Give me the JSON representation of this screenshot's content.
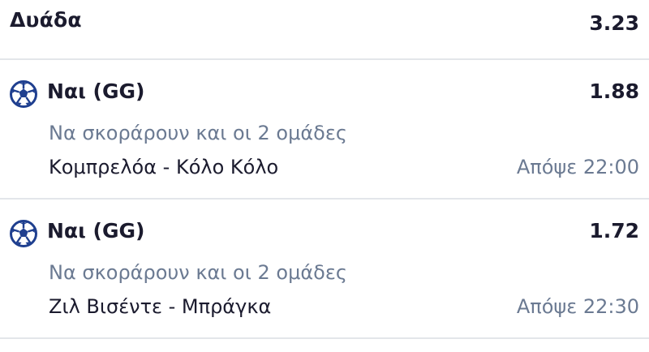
{
  "header": {
    "title": "Δυάδα",
    "odds": "3.23"
  },
  "selections": [
    {
      "name": "Ναι (GG)",
      "odds": "1.88",
      "market": "Να σκοράρουν και οι 2 ομάδες",
      "match": "Κομπρελόα - Κόλο Κόλο",
      "time": "Απόψε 22:00",
      "icon": "soccer-ball-icon"
    },
    {
      "name": "Ναι (GG)",
      "odds": "1.72",
      "market": "Να σκοράρουν και οι 2 ομάδες",
      "match": "Ζιλ Βισέντε - Μπράγκα",
      "time": "Απόψε 22:30",
      "icon": "soccer-ball-icon"
    }
  ],
  "colors": {
    "text": "#1b1b2e",
    "muted": "#6b7a92",
    "divider": "#e3e6ea",
    "icon": "#1f3f8f"
  }
}
